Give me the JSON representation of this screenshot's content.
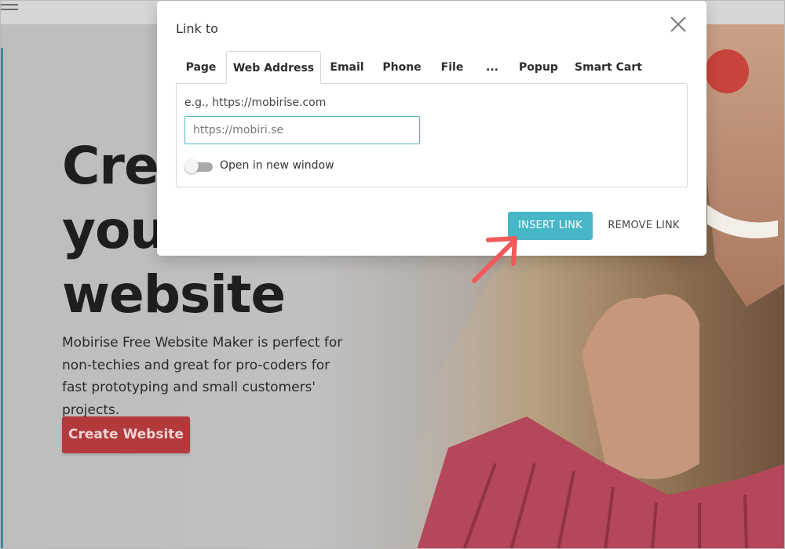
{
  "colors": {
    "accent": "#47b6c7",
    "hero_button": "#b23a3c",
    "annotation_arrow": "#f05a5a"
  },
  "background_page": {
    "menu_icon": "hamburger-icon",
    "hero_title_lines": [
      "Cre",
      "you",
      "website"
    ],
    "hero_text": "Mobirise Free Website Maker is perfect for non-techies and great for pro-coders for fast prototyping and small customers' projects.",
    "hero_button_label": "Create Website"
  },
  "dialog": {
    "title": "Link to",
    "close_icon": "close-icon",
    "tabs": [
      {
        "label": "Page",
        "active": false
      },
      {
        "label": "Web Address",
        "active": true
      },
      {
        "label": "Email",
        "active": false
      },
      {
        "label": "Phone",
        "active": false
      },
      {
        "label": "File",
        "active": false
      },
      {
        "label": "...",
        "active": false
      },
      {
        "label": "Popup",
        "active": false
      },
      {
        "label": "Smart Cart",
        "active": false
      }
    ],
    "hint": "e.g., https://mobirise.com",
    "url_value": "https://mobiri.se",
    "toggle": {
      "label": "Open in new window",
      "on": false
    },
    "insert_label": "INSERT LINK",
    "remove_label": "REMOVE LINK"
  }
}
